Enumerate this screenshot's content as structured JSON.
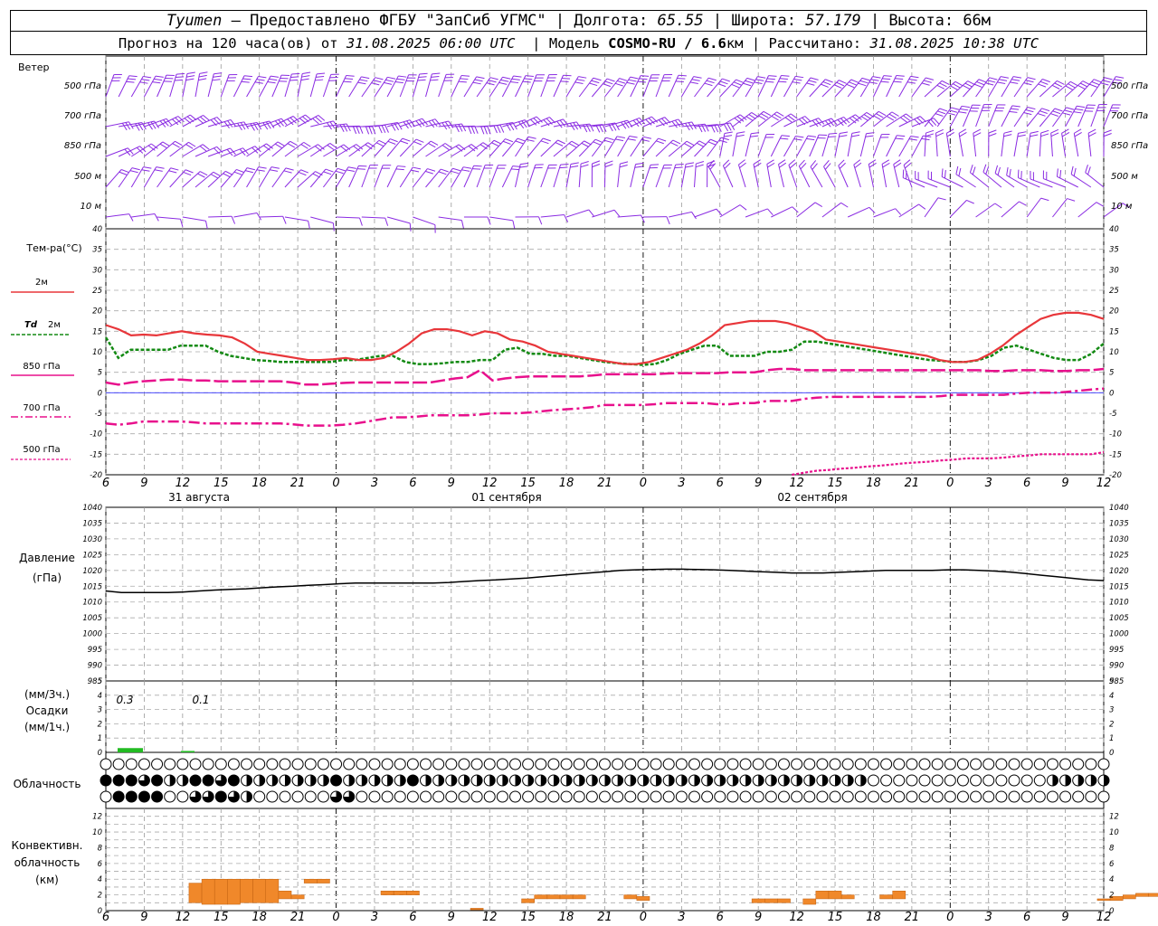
{
  "header": {
    "city": "Tyumen",
    "provider": "– Предоставлено ФГБУ \"ЗапСиб УГМС\" | Долгота:",
    "lon": "65.55",
    "lat_label": "| Широта:",
    "lat": "57.179",
    "alt_label": "| Высота:",
    "alt": "66м",
    "forecast_label": "Прогноз на 120 часа(ов) от",
    "forecast_start": "31.08.2025 06:00 UTC",
    "model_label": "| Модель",
    "model": "COSMO-RU / 6.6",
    "model_unit": "км | Рассчитано:",
    "calc_time": "31.08.2025 10:38 UTC"
  },
  "labels": {
    "wind": "Ветер",
    "wind_levels": [
      "500 гПа",
      "700 гПа",
      "850 гПа",
      "500 м",
      "10   м"
    ],
    "temp_title": "Тем-ра(°С)",
    "t2m": "2м",
    "td": "Td",
    "td2m": "2м",
    "t850": "850 гПа",
    "t700": "700 гПа",
    "t500": "500 гПа",
    "pressure1": "Давление",
    "pressure2": "(гПа)",
    "precip1": "(мм/3ч.)",
    "precip2": "Осадки",
    "precip3": "(мм/1ч.)",
    "cloud": "Облачность",
    "conv1": "Конвективн.",
    "conv2": "облачность",
    "conv3": "(км)",
    "precip_values": [
      "0.3",
      "0.1"
    ],
    "date_labels": [
      "31 августа",
      "01 сентября",
      "02 сентября"
    ]
  },
  "colors": {
    "t2m": "#e8363a",
    "td": "#138a13",
    "magenta": "#e8108c",
    "wind": "#8a2be2",
    "pressure": "#000000",
    "precip": "#22bb22",
    "conv": "#f0882a"
  },
  "chart_data": [
    {
      "type": "line",
      "title": "Тем-ра(°С)",
      "x_hours_ticks": [
        "6",
        "9",
        "12",
        "15",
        "18",
        "21",
        "0",
        "3",
        "6",
        "9",
        "12",
        "15",
        "18",
        "21",
        "0",
        "3",
        "6",
        "9",
        "12",
        "15",
        "18",
        "21",
        "0",
        "3",
        "6",
        "9",
        "12"
      ],
      "ylim": [
        -20,
        40
      ],
      "series": [
        {
          "name": "2м",
          "values": [
            16.5,
            15.5,
            14,
            14.2,
            14,
            14.5,
            15,
            14.5,
            14.2,
            14,
            13.5,
            12,
            10,
            9.5,
            9,
            8.5,
            8,
            8,
            8.2,
            8.5,
            8,
            8,
            8.5,
            10,
            12,
            14.5,
            15.5,
            15.5,
            15,
            14,
            15,
            14.5,
            13,
            12.5,
            11.5,
            10,
            9.5,
            9,
            8.5,
            8,
            7.5,
            7,
            7,
            7.5,
            8.5,
            9.5,
            10.5,
            12,
            14,
            16.5,
            17,
            17.5,
            17.5,
            17.5,
            17,
            16,
            15,
            13,
            12.5,
            12,
            11.5,
            11,
            10.5,
            10,
            9.5,
            9,
            8,
            7.5,
            7.5,
            8,
            9.5,
            11.5,
            14,
            16,
            18,
            19,
            19.5,
            19.5,
            19,
            18
          ]
        },
        {
          "name": "Td 2м",
          "values": [
            13.5,
            8.5,
            10.5,
            10.5,
            10.5,
            10.5,
            11.5,
            11.5,
            11.5,
            10,
            9,
            8.5,
            8,
            7.8,
            7.5,
            7.5,
            7.5,
            7.5,
            7.5,
            8,
            8,
            8.5,
            9,
            9,
            7.5,
            7,
            7,
            7.2,
            7.5,
            7.5,
            8,
            8,
            10.5,
            11,
            9.5,
            9.5,
            9,
            9,
            8.5,
            8,
            7.5,
            7.2,
            7,
            6.8,
            7,
            8,
            9.5,
            10.5,
            11.5,
            11.5,
            9,
            9,
            9,
            10,
            10,
            10.5,
            12.5,
            12.5,
            12,
            11.5,
            11,
            10.5,
            10,
            9.5,
            9,
            8.5,
            8,
            7.8,
            7.5,
            7.5,
            8,
            9,
            11,
            11.5,
            10.5,
            9.5,
            8.5,
            8,
            8,
            9.5,
            12
          ]
        },
        {
          "name": "850 гПа",
          "values": [
            2.5,
            2,
            2.5,
            2.8,
            3,
            3.2,
            3.2,
            3,
            3,
            2.8,
            2.8,
            2.8,
            2.8,
            2.8,
            2.8,
            2.5,
            2,
            2,
            2.2,
            2.4,
            2.5,
            2.5,
            2.5,
            2.5,
            2.5,
            2.5,
            2.5,
            3,
            3.5,
            3.8,
            5.5,
            3,
            3.5,
            3.8,
            4,
            4,
            4,
            4,
            4,
            4.2,
            4.5,
            4.5,
            4.5,
            4.5,
            4.5,
            4.7,
            4.8,
            4.8,
            4.8,
            4.8,
            5,
            5,
            5,
            5.5,
            5.8,
            5.8,
            5.5,
            5.5,
            5.5,
            5.5,
            5.5,
            5.5,
            5.5,
            5.5,
            5.5,
            5.5,
            5.5,
            5.5,
            5.5,
            5.5,
            5.5,
            5.3,
            5.3,
            5.5,
            5.5,
            5.5,
            5.3,
            5.3,
            5.5,
            5.5,
            5.8
          ]
        },
        {
          "name": "700 гПа",
          "values": [
            -7.5,
            -7.8,
            -7.5,
            -7,
            -7,
            -7,
            -7,
            -7.2,
            -7.5,
            -7.5,
            -7.5,
            -7.5,
            -7.5,
            -7.5,
            -7.5,
            -7.7,
            -8,
            -8,
            -8,
            -7.8,
            -7.5,
            -7,
            -6.5,
            -6,
            -6,
            -5.8,
            -5.5,
            -5.5,
            -5.5,
            -5.5,
            -5.3,
            -5,
            -5,
            -5,
            -4.8,
            -4.5,
            -4.2,
            -4,
            -3.8,
            -3.5,
            -3,
            -3,
            -3,
            -3,
            -2.8,
            -2.5,
            -2.5,
            -2.5,
            -2.5,
            -2.8,
            -2.8,
            -2.5,
            -2.5,
            -2,
            -2,
            -2,
            -1.5,
            -1.2,
            -1,
            -1,
            -1,
            -1,
            -1,
            -1,
            -1,
            -1,
            -1,
            -0.8,
            -0.5,
            -0.5,
            -0.5,
            -0.5,
            -0.5,
            -0.2,
            0,
            0,
            0,
            0.2,
            0.5,
            0.8,
            1
          ]
        },
        {
          "name": "500 гПа",
          "values": [
            null,
            null,
            null,
            null,
            null,
            null,
            null,
            null,
            null,
            null,
            null,
            null,
            null,
            null,
            null,
            null,
            null,
            null,
            null,
            null,
            null,
            null,
            null,
            null,
            null,
            null,
            null,
            null,
            null,
            null,
            null,
            null,
            null,
            null,
            null,
            null,
            null,
            null,
            null,
            null,
            null,
            null,
            null,
            null,
            null,
            null,
            null,
            null,
            null,
            null,
            null,
            null,
            null,
            null,
            null,
            -20,
            -19.5,
            -19,
            -18.8,
            -18.5,
            -18.3,
            -18,
            -17.8,
            -17.5,
            -17.2,
            -17,
            -16.8,
            -16.5,
            -16.3,
            -16,
            -16,
            -16,
            -15.8,
            -15.5,
            -15.3,
            -15,
            -15,
            -15,
            -15,
            -15,
            -14.5
          ]
        }
      ]
    },
    {
      "type": "line",
      "title": "Давление",
      "ylim": [
        985,
        1040
      ],
      "series": [
        {
          "name": "(гПа)",
          "values": [
            1013.5,
            1013,
            1013,
            1013,
            1013,
            1013.2,
            1013.5,
            1013.8,
            1014,
            1014.2,
            1014.5,
            1014.8,
            1015,
            1015.3,
            1015.5,
            1015.8,
            1016,
            1016,
            1016,
            1016,
            1016,
            1016,
            1016.2,
            1016.5,
            1016.8,
            1017,
            1017.3,
            1017.6,
            1018,
            1018.4,
            1018.8,
            1019.2,
            1019.6,
            1020,
            1020.2,
            1020.3,
            1020.4,
            1020.4,
            1020.3,
            1020.2,
            1020,
            1019.8,
            1019.6,
            1019.4,
            1019.2,
            1019.2,
            1019.2,
            1019.4,
            1019.6,
            1019.8,
            1020,
            1020,
            1020,
            1020,
            1020.2,
            1020.2,
            1020,
            1019.8,
            1019.5,
            1019,
            1018.5,
            1018,
            1017.5,
            1017,
            1016.8
          ]
        }
      ]
    },
    {
      "type": "bar",
      "title": "Осадки",
      "ylim": [
        0,
        5
      ],
      "categories": [
        "9",
        "12"
      ],
      "values": [
        0.3,
        0.1
      ]
    },
    {
      "type": "bar",
      "title": "Конвективн. облачность",
      "ylim": [
        0,
        13
      ],
      "segments": [
        {
          "hour": 7,
          "base": 1,
          "top": 3.5
        },
        {
          "hour": 8,
          "base": 0.8,
          "top": 4
        },
        {
          "hour": 9,
          "base": 0.8,
          "top": 4
        },
        {
          "hour": 10,
          "base": 0.8,
          "top": 4
        },
        {
          "hour": 11,
          "base": 1,
          "top": 4
        },
        {
          "hour": 12,
          "base": 1,
          "top": 4
        },
        {
          "hour": 13,
          "base": 1,
          "top": 4
        },
        {
          "hour": 14,
          "base": 1.5,
          "top": 2.5
        },
        {
          "hour": 15,
          "base": 1.5,
          "top": 2
        },
        {
          "hour": 16,
          "base": 3.5,
          "top": 4
        },
        {
          "hour": 17,
          "base": 3.5,
          "top": 4
        },
        {
          "hour": 22,
          "base": 2,
          "top": 2.5
        },
        {
          "hour": 23,
          "base": 2,
          "top": 2.5
        },
        {
          "hour": 24,
          "base": 2,
          "top": 2.5
        },
        {
          "hour": 29,
          "base": 0.1,
          "top": 0.3
        },
        {
          "hour": 33,
          "base": 1,
          "top": 1.5
        },
        {
          "hour": 34,
          "base": 1.5,
          "top": 2
        },
        {
          "hour": 35,
          "base": 1.5,
          "top": 2
        },
        {
          "hour": 36,
          "base": 1.5,
          "top": 2
        },
        {
          "hour": 37,
          "base": 1.5,
          "top": 2
        },
        {
          "hour": 41,
          "base": 1.5,
          "top": 2
        },
        {
          "hour": 42,
          "base": 1.3,
          "top": 1.8
        },
        {
          "hour": 51,
          "base": 1,
          "top": 1.5
        },
        {
          "hour": 52,
          "base": 1,
          "top": 1.5
        },
        {
          "hour": 53,
          "base": 1,
          "top": 1.5
        },
        {
          "hour": 55,
          "base": 0.8,
          "top": 1.5
        },
        {
          "hour": 56,
          "base": 1.5,
          "top": 2.5
        },
        {
          "hour": 57,
          "base": 1.5,
          "top": 2.5
        },
        {
          "hour": 58,
          "base": 1.5,
          "top": 2
        },
        {
          "hour": 61,
          "base": 1.5,
          "top": 2
        },
        {
          "hour": 62,
          "base": 1.5,
          "top": 2.5
        },
        {
          "hour": 78,
          "base": 1.3,
          "top": 1.5
        },
        {
          "hour": 79,
          "base": 1.3,
          "top": 1.8
        },
        {
          "hour": 80,
          "base": 1.5,
          "top": 2
        },
        {
          "hour": 81,
          "base": 1.8,
          "top": 2.2
        },
        {
          "hour": 82,
          "base": 1.8,
          "top": 2.2
        },
        {
          "hour": 83,
          "base": 1.8,
          "top": 2.2
        }
      ]
    },
    {
      "type": "table",
      "title": "Облачность",
      "rows": [
        "0000000000000000000000000000000000000000000000000000000000000000000000000000000000000000000000000000000000000000000000000000000000000000000000000000000000000000000000000000000000000000000000000000000000000000000000000000000000000000000000000000000000000000000000000000000000000000000000000000000",
        "4443422443422222224222224222222222222222222222222222222222220000000000000022222222222222222222222222222222222222222222222222222222222222222222222222222222222222222222222222222222222222222222222222222222222222222222222222222222222222222222222222222222222222222222222222222244444444444",
        "04444003343200000033000000000000000000000000000000000000000000000000000000000000000000000000000000000000000000000000000000000000000000000000000000000000000000000000000000000000000000000000000000000000000000000000000000000000000000000000000000000000000000000000000000000000000000000004"
      ]
    }
  ]
}
